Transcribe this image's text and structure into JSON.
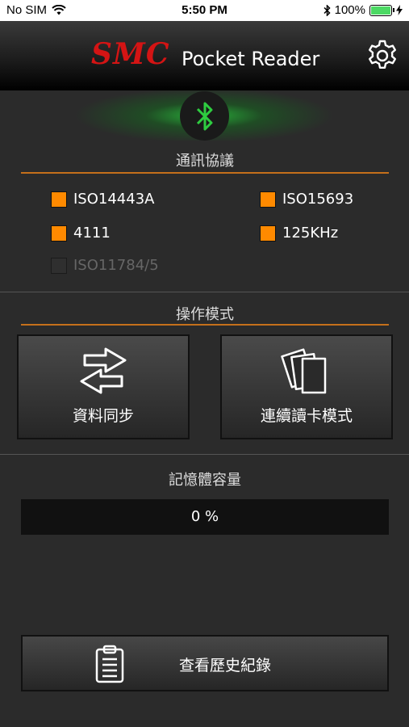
{
  "status_bar": {
    "carrier": "No SIM",
    "time": "5:50 PM",
    "battery": "100%"
  },
  "header": {
    "brand": "SMC",
    "title": "Pocket Reader"
  },
  "protocols": {
    "title": "通訊協議",
    "items": [
      {
        "label": "ISO14443A",
        "checked": true,
        "enabled": true
      },
      {
        "label": "ISO15693",
        "checked": true,
        "enabled": true
      },
      {
        "label": "4111",
        "checked": true,
        "enabled": true
      },
      {
        "label": "125KHz",
        "checked": true,
        "enabled": true
      },
      {
        "label": "ISO11784/5",
        "checked": false,
        "enabled": false
      }
    ]
  },
  "modes": {
    "title": "操作模式",
    "sync_label": "資料同步",
    "continuous_label": "連續讀卡模式"
  },
  "memory": {
    "title": "記憶體容量",
    "value": "0 %",
    "progress_percent": 0
  },
  "history": {
    "label": "查看歷史紀錄"
  },
  "colors": {
    "accent": "#ff8a00",
    "brand_red": "#d41414",
    "bluetooth_green": "#2ecc40",
    "divider_orange": "#c4701b"
  }
}
